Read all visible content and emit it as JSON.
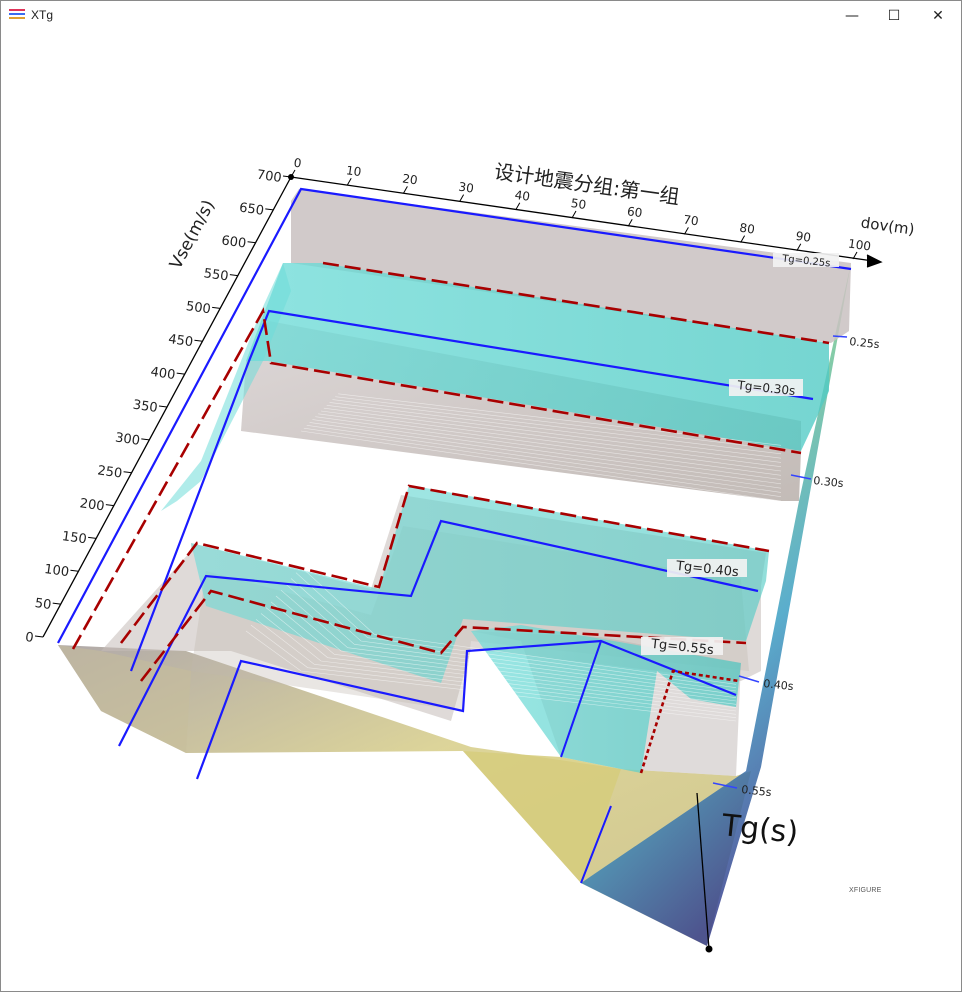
{
  "window": {
    "title": "XTg",
    "controls": {
      "minimize": "—",
      "maximize": "☐",
      "close": "✕"
    },
    "icon": "app-stripes-icon"
  },
  "chart_data": {
    "type": "surface-3d",
    "title": "设计地震分组:第一组",
    "xlabel": "dov(m)",
    "ylabel": "Vse(m/s)",
    "zlabel": "Tg(s)",
    "x_ticks": [
      "0",
      "10",
      "20",
      "30",
      "40",
      "50",
      "60",
      "70",
      "80",
      "90",
      "100"
    ],
    "y_ticks": [
      "0",
      "50",
      "100",
      "150",
      "200",
      "250",
      "300",
      "350",
      "400",
      "450",
      "500",
      "550",
      "600",
      "650",
      "700"
    ],
    "xlim": [
      0,
      100
    ],
    "ylim": [
      0,
      700
    ],
    "z_tick_labels": [
      "0.25s",
      "0.30s",
      "0.40s",
      "0.55s"
    ],
    "contour_labels": [
      "Tg=0.25s",
      "Tg=0.30s",
      "Tg=0.40s",
      "Tg=0.55s"
    ],
    "contour_levels": [
      0.25,
      0.3,
      0.4,
      0.55
    ],
    "watermark": "XFIGURE",
    "colors": {
      "contour_line": "#1a1aff",
      "boundary_dash": "#a80000",
      "transition_band": "#5ed8d4",
      "plateau_top": "#cfc6c6",
      "wall_light": "#d8d08a",
      "wall_dark": "#3a4a9a"
    }
  }
}
